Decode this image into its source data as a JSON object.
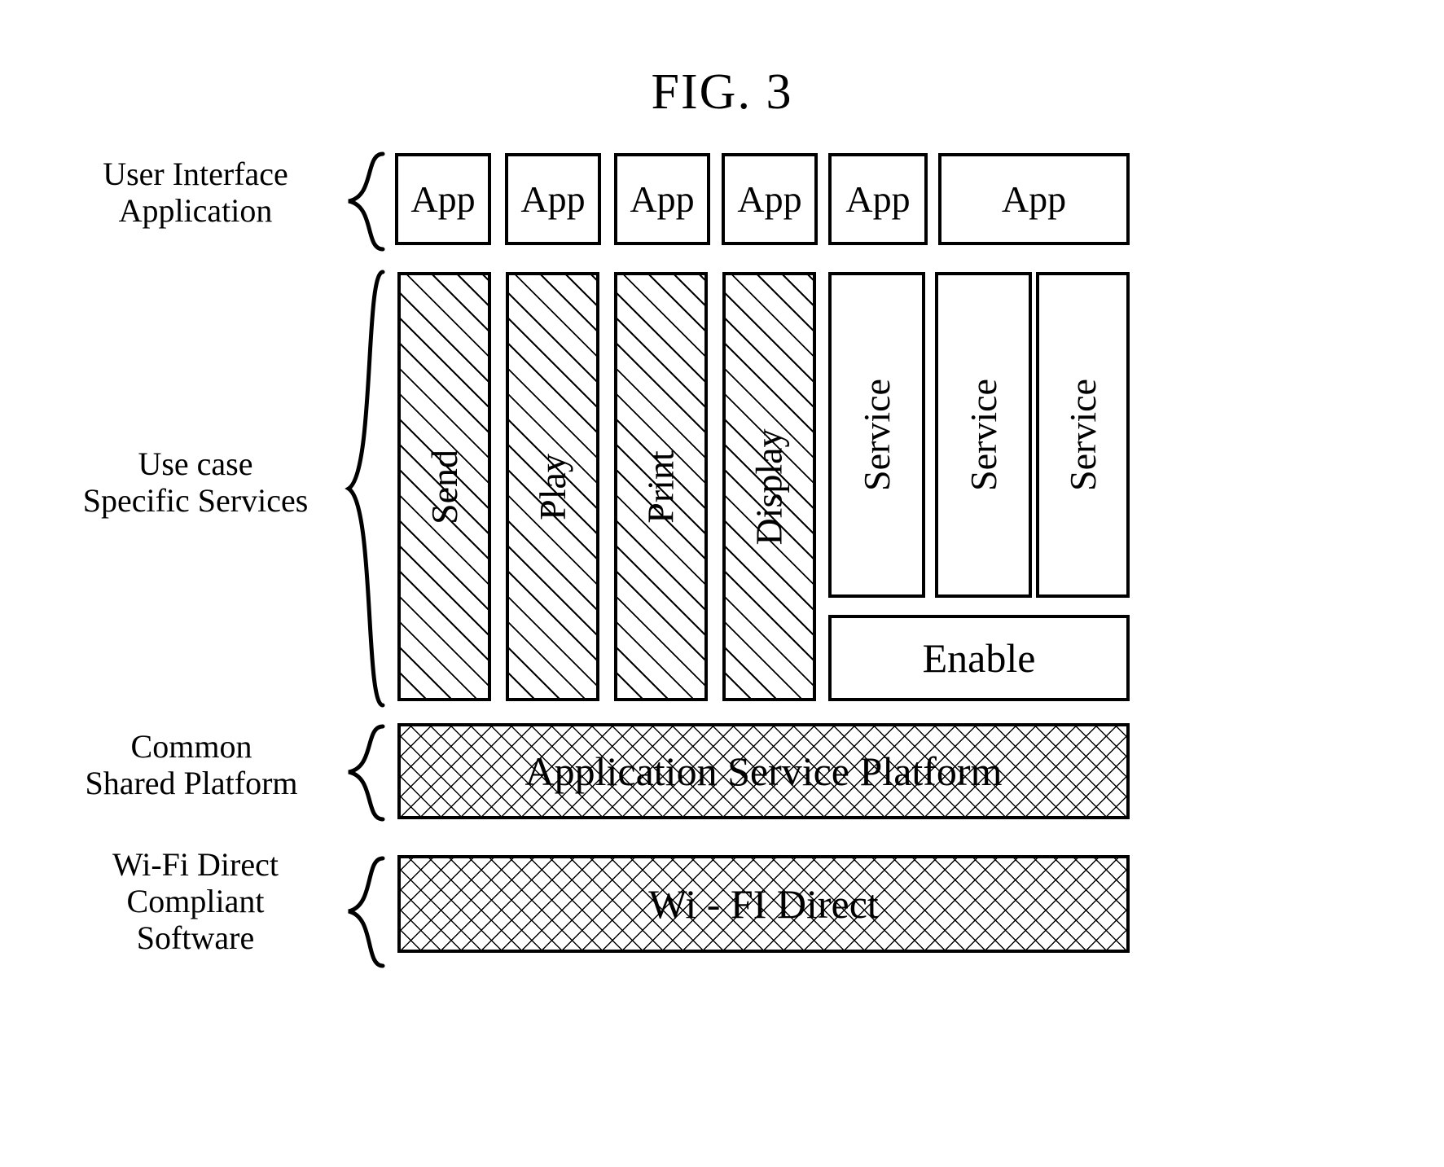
{
  "figure": {
    "title": "FIG. 3"
  },
  "row_labels": [
    {
      "id": "user-interface-application",
      "lines": [
        "User Interface",
        "Application"
      ]
    },
    {
      "id": "use-case-specific-services",
      "lines": [
        "Use case",
        "Specific Services"
      ]
    },
    {
      "id": "common-shared-platform",
      "lines": [
        "Common",
        "Shared Platform"
      ]
    },
    {
      "id": "wifi-direct-compliant-software",
      "lines": [
        "Wi-Fi Direct",
        "Compliant",
        "Software"
      ]
    }
  ],
  "layers": {
    "application_row": {
      "boxes": [
        {
          "label": "App"
        },
        {
          "label": "App"
        },
        {
          "label": "App"
        },
        {
          "label": "App"
        },
        {
          "label": "App"
        },
        {
          "label": "App"
        }
      ]
    },
    "service_row": {
      "hatched_columns": [
        {
          "label": "Send"
        },
        {
          "label": "Play"
        },
        {
          "label": "Print"
        },
        {
          "label": "Display"
        }
      ],
      "plain_columns": [
        {
          "label": "Service"
        },
        {
          "label": "Service"
        },
        {
          "label": "Service"
        }
      ],
      "enable_box": {
        "label": "Enable"
      }
    },
    "platform_bar": {
      "label": "Application Service Platform"
    },
    "wifi_bar": {
      "label": "Wi - FI Direct"
    }
  }
}
